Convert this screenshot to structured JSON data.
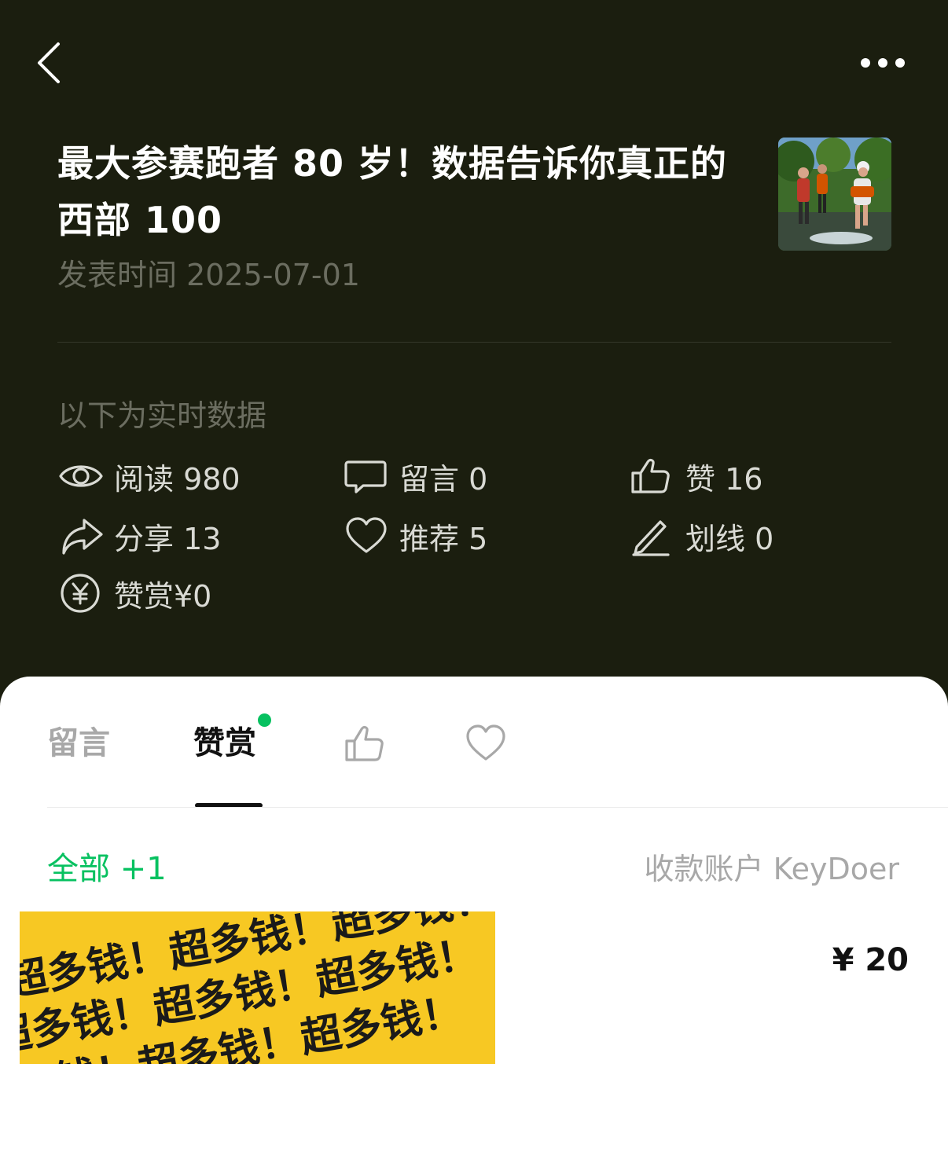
{
  "article": {
    "title": "最大参赛跑者 80 岁！数据告诉你真正的西部 100",
    "publish_label": "发表时间 2025-07-01"
  },
  "realtime_label": "以下为实时数据",
  "stats": {
    "read": "阅读 980",
    "comment": "留言 0",
    "like": "赞 16",
    "share": "分享 13",
    "recommend": "推荐 5",
    "underline": "划线 0",
    "reward": "赞赏¥0"
  },
  "tabs": {
    "comments": "留言",
    "rewards": "赞赏"
  },
  "reward_section": {
    "filter": "全部 +1",
    "account": "收款账户 KeyDoer",
    "image_text": "超多钱！",
    "amount": "¥ 20"
  },
  "icons": {
    "back": "chevron-left-icon",
    "more": "ellipsis-icon",
    "read": "eye-icon",
    "comment": "speech-bubble-icon",
    "like": "thumbs-up-icon",
    "share": "share-arrow-icon",
    "recommend": "heart-icon",
    "underline": "pen-icon",
    "reward": "yen-circle-icon"
  },
  "colors": {
    "background_dark": "#1b1e0f",
    "accent_green": "#07c160",
    "reward_yellow": "#f7c823"
  }
}
